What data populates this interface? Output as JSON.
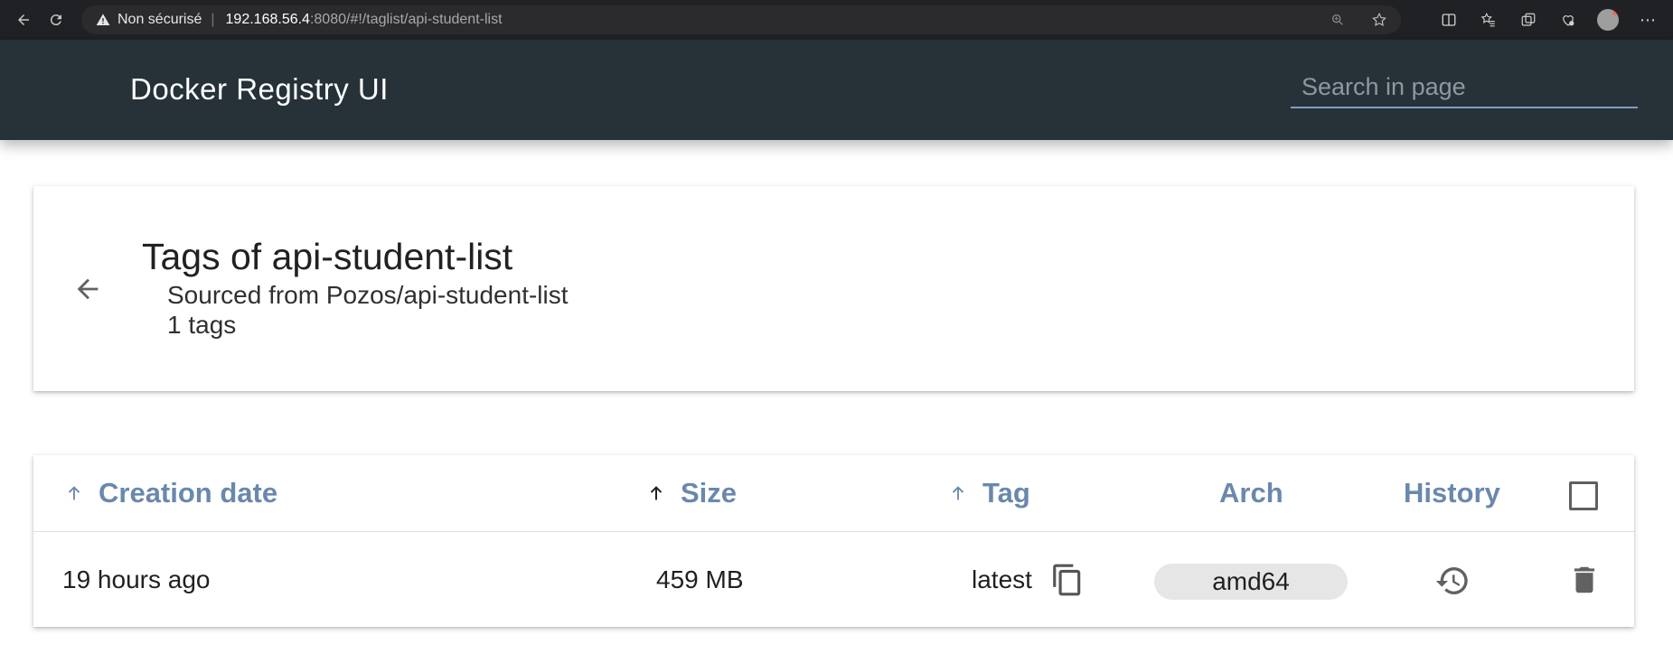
{
  "browser": {
    "security_label": "Non sécurisé",
    "url_host": "192.168.56.4",
    "url_rest": ":8080/#!/taglist/api-student-list"
  },
  "header": {
    "title": "Docker Registry UI",
    "search_placeholder": "Search in page"
  },
  "info": {
    "title": "Tags of api-student-list",
    "source": "Sourced from Pozos/api-student-list",
    "count": "1 tags"
  },
  "table": {
    "columns": {
      "creation": "Creation date",
      "size": "Size",
      "tag": "Tag",
      "arch": "Arch",
      "history": "History"
    },
    "rows": [
      {
        "date": "19 hours ago",
        "size": "459 MB",
        "tag": "latest",
        "arch": "amd64"
      }
    ]
  },
  "colors": {
    "header_bg": "#263238",
    "column_header": "#6a88ad",
    "browser_bg": "#202124"
  },
  "icons": [
    "back-icon",
    "reload-icon",
    "warning-icon",
    "zoom-icon",
    "star-icon",
    "split-screen-icon",
    "favorites-icon",
    "collections-icon",
    "extensions-icon",
    "profile-icon",
    "more-icon",
    "arrow-left-icon",
    "sort-arrow-icon",
    "copy-icon",
    "history-icon",
    "delete-icon"
  ]
}
